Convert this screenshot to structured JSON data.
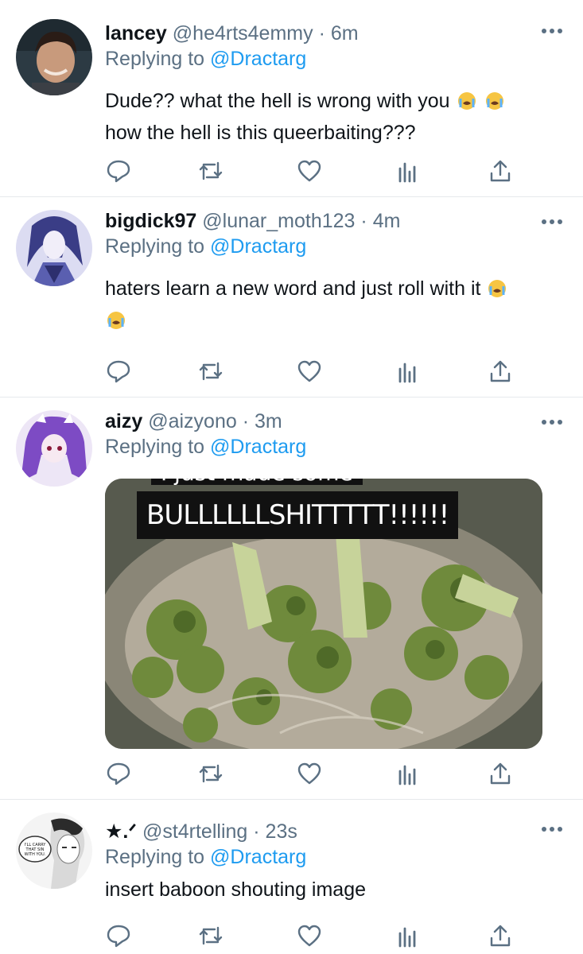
{
  "colors": {
    "link": "#1d9bf0",
    "secondary": "#5b7083",
    "text": "#0f1419",
    "divider": "#e6e9ec"
  },
  "icons": [
    "reply-icon",
    "retweet-icon",
    "like-icon",
    "analytics-icon",
    "share-icon",
    "more-icon",
    "crying-emoji"
  ],
  "tweets": [
    {
      "name": "lancey",
      "handle": "@he4rts4emmy",
      "time": "6m",
      "replying_prefix": "Replying to",
      "replying_to": "@Dractarg",
      "text_line1": "Dude?? what the hell is wrong with you",
      "text_line2": "how the hell is this queerbaiting???"
    },
    {
      "name": "bigdick97",
      "handle": "@lunar_moth123",
      "time": "4m",
      "replying_prefix": "Replying to",
      "replying_to": "@Dractarg",
      "text_line1": "haters learn a new word and just roll with it"
    },
    {
      "name": "aizy",
      "handle": "@aizyono",
      "time": "3m",
      "replying_prefix": "Replying to",
      "replying_to": "@Dractarg",
      "image_caption": "BULLLLLLSHITTTTT!!!!!!",
      "image_caption_partial": "I just made some"
    },
    {
      "name": "★.ᐟ",
      "handle": "@st4rtelling",
      "time": "23s",
      "replying_prefix": "Replying to",
      "replying_to": "@Dractarg",
      "text_line1": "insert baboon shouting image",
      "avatar_bubble_text": "I'LL CARRY THAT SIN WITH YOU."
    }
  ]
}
